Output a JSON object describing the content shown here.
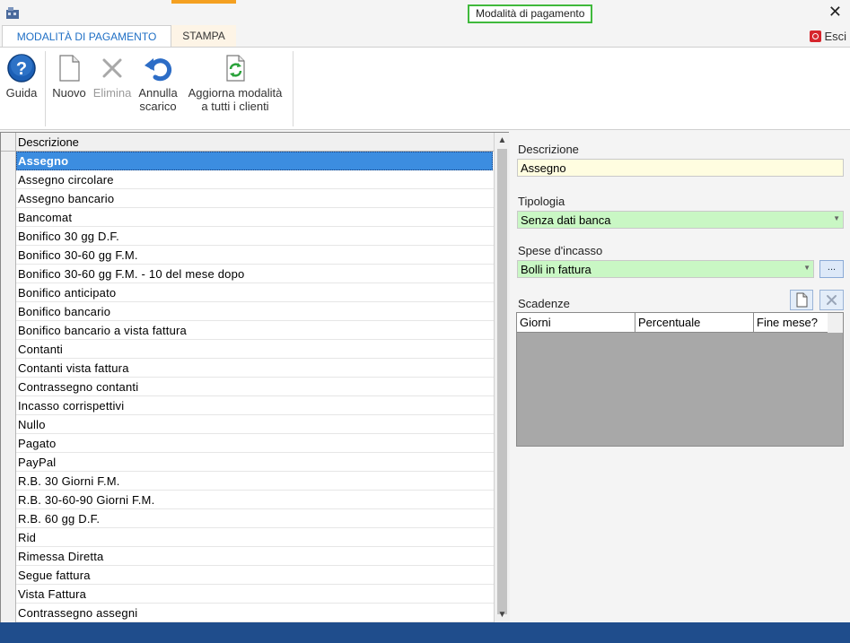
{
  "window": {
    "title": "Modalità di pagamento",
    "close_icon": "close-icon"
  },
  "ribbon": {
    "tabs": [
      {
        "label": "MODALITÀ DI PAGAMENTO",
        "active": true
      },
      {
        "label": "STAMPA",
        "active": false
      }
    ],
    "exit_label": "Esci",
    "buttons": {
      "help": {
        "label": "Guida",
        "icon": "help-icon",
        "enabled": true
      },
      "new": {
        "label": "Nuovo",
        "icon": "new-document-icon",
        "enabled": true
      },
      "delete": {
        "label": "Elimina",
        "icon": "delete-x-icon",
        "enabled": false
      },
      "undo_line1": "Annulla",
      "undo_line2": "scarico",
      "update_line1": "Aggiorna modalità",
      "update_line2": "a tutti i clienti"
    }
  },
  "grid": {
    "header": "Descrizione",
    "rows": [
      "Assegno",
      "Assegno circolare",
      "Assegno bancario",
      "Bancomat",
      "Bonifico 30 gg D.F.",
      "Bonifico 30-60 gg F.M.",
      "Bonifico 30-60 gg F.M. - 10 del mese dopo",
      "Bonifico anticipato",
      "Bonifico bancario",
      "Bonifico bancario a vista fattura",
      "Contanti",
      "Contanti vista fattura",
      "Contrassegno contanti",
      "Incasso corrispettivi",
      "Nullo",
      "Pagato",
      "PayPal",
      "R.B. 30 Giorni F.M.",
      "R.B. 30-60-90 Giorni F.M.",
      "R.B. 60 gg D.F.",
      "Rid",
      "Rimessa Diretta",
      "Segue fattura",
      "Vista Fattura",
      "Contrassegno assegni"
    ],
    "selected_index": 0
  },
  "detail": {
    "descrizione_label": "Descrizione",
    "descrizione_value": "Assegno",
    "tipologia_label": "Tipologia",
    "tipologia_value": "Senza dati banca",
    "spese_label": "Spese d'incasso",
    "spese_value": "Bolli in fattura",
    "dots_label": "...",
    "scadenze_label": "Scadenze",
    "scadenze_columns": [
      "Giorni",
      "Percentuale",
      "Fine mese?"
    ]
  },
  "colors": {
    "accent_blue": "#1f6fc5",
    "selection": "#3c8de0",
    "status_bar": "#1f4d8c",
    "title_border": "#40b93c",
    "tab_accent": "#f4a020"
  }
}
